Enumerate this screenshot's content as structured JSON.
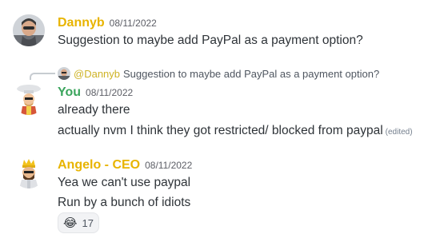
{
  "messages": [
    {
      "author": "Dannyb",
      "author_color": "#e8b400",
      "timestamp": "08/11/2022",
      "lines": [
        "Suggestion to maybe add PayPal as a payment option?"
      ]
    },
    {
      "reply_to": {
        "mention": "@Dannyb",
        "text": "Suggestion to maybe add PayPal as a payment option?"
      },
      "author": "You",
      "author_color": "#3ba55d",
      "timestamp": "08/11/2022",
      "lines": [
        "already there",
        "actually nvm I think they got restricted/ blocked from paypal"
      ],
      "edited_label": "(edited)"
    },
    {
      "author": "Angelo - CEO",
      "author_color": "#e8b400",
      "timestamp": "08/11/2022",
      "lines": [
        "Yea we can't use paypal",
        "Run by a bunch of idiots"
      ],
      "reaction": {
        "emoji": "😂",
        "count": "17"
      }
    }
  ]
}
